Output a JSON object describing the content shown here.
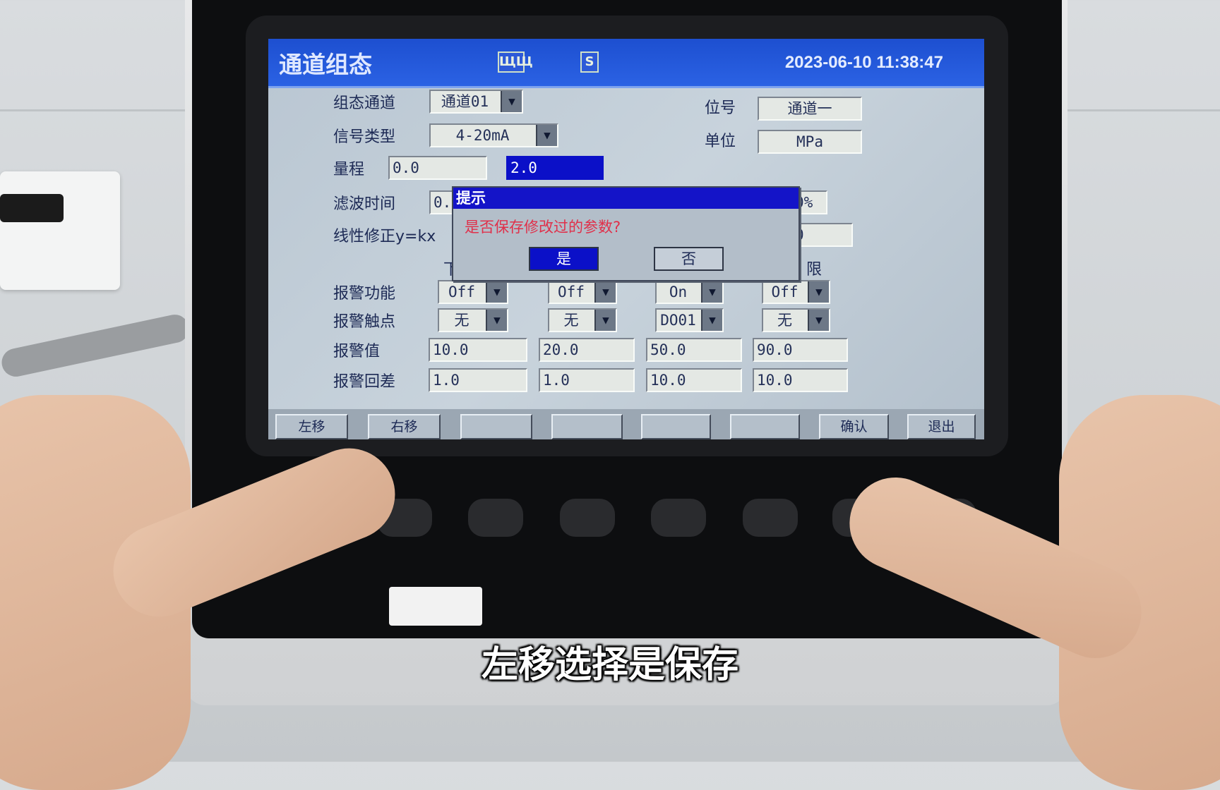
{
  "header": {
    "title": "通道组态",
    "icon_pulse": "ЩЩ",
    "icon_s": "S",
    "datetime": "2023-06-10 11:38:47"
  },
  "form": {
    "channel": {
      "label": "组态通道",
      "value": "通道01"
    },
    "signal": {
      "label": "信号类型",
      "value": "4-20mA"
    },
    "range": {
      "label": "量程",
      "low": "0.0",
      "high": "2.0"
    },
    "filter": {
      "label": "滤波时间",
      "value": "0.",
      "right_value": "0%"
    },
    "linear": {
      "label": "线性修正y=kx",
      "right_value": "0"
    },
    "tag": {
      "label": "位号",
      "value": "通道一"
    },
    "unit": {
      "label": "单位",
      "value": "MPa"
    },
    "col_header_left": "下",
    "col_header_right": "限"
  },
  "alarm": {
    "function": {
      "label": "报警功能",
      "values": [
        "Off",
        "Off",
        "On",
        "Off"
      ]
    },
    "contact": {
      "label": "报警触点",
      "values": [
        "无",
        "无",
        "DO01",
        "无"
      ]
    },
    "value": {
      "label": "报警值",
      "values": [
        "10.0",
        "20.0",
        "50.0",
        "90.0"
      ]
    },
    "hysteresis": {
      "label": "报警回差",
      "values": [
        "1.0",
        "1.0",
        "10.0",
        "10.0"
      ]
    }
  },
  "dialog": {
    "title": "提示",
    "message": "是否保存修改过的参数?",
    "yes": "是",
    "no": "否"
  },
  "footer": {
    "buttons": [
      "左移",
      "右移",
      "",
      "",
      "",
      "",
      "确认",
      "退出"
    ]
  },
  "subtitle": "左移选择是保存",
  "colors": {
    "title_bar": "#1d4fd0",
    "selected": "#0b10c8",
    "dialog_message": "#e0304a"
  }
}
